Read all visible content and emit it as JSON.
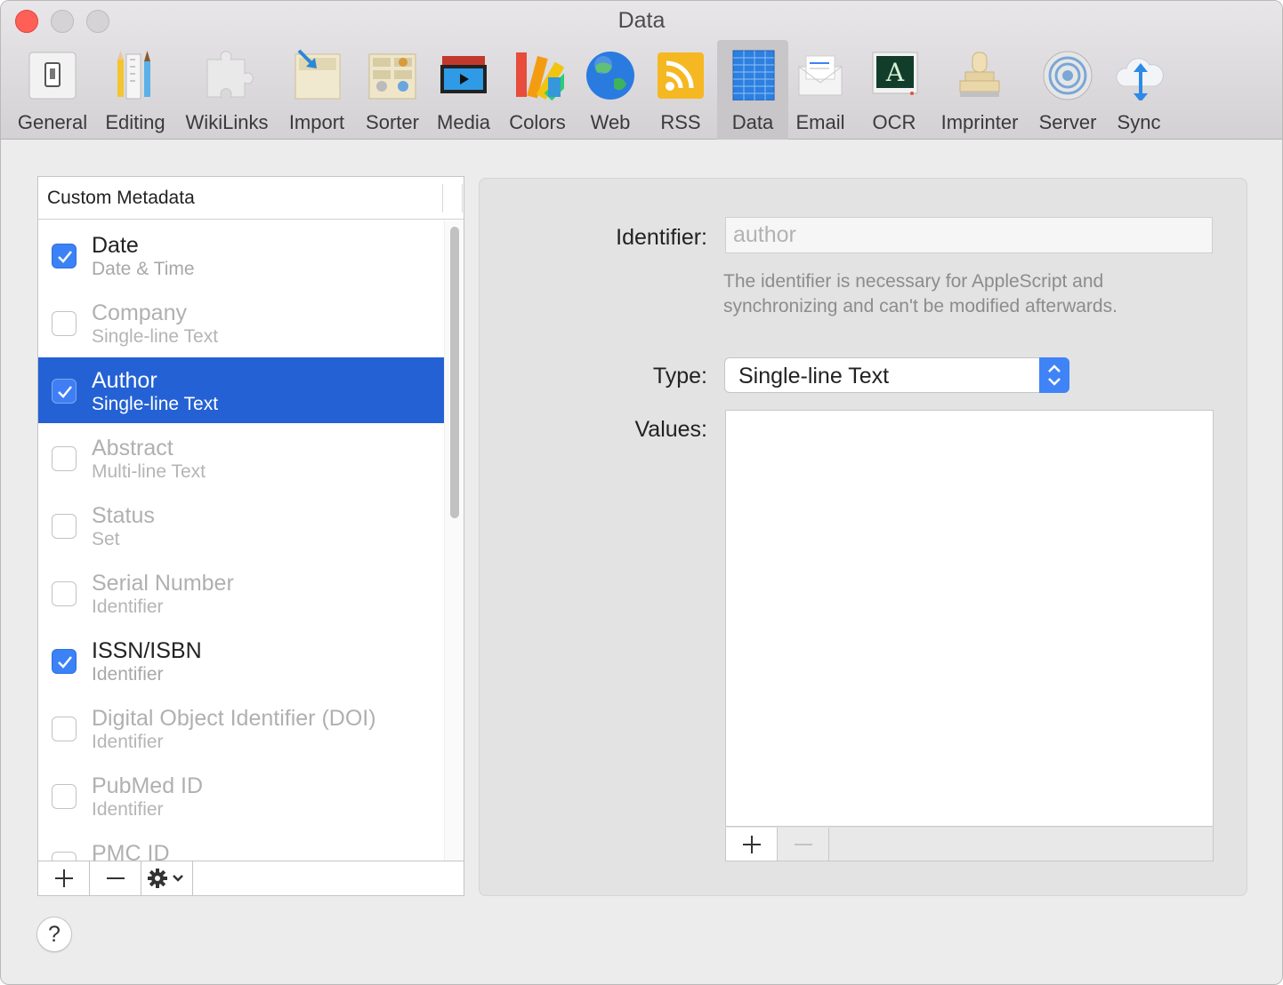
{
  "window": {
    "title": "Data"
  },
  "toolbar": {
    "selected": "Data",
    "items": [
      {
        "label": "General",
        "icon": "switch-icon"
      },
      {
        "label": "Editing",
        "icon": "pencil-ruler-icon"
      },
      {
        "label": "WikiLinks",
        "icon": "puzzle-icon"
      },
      {
        "label": "Import",
        "icon": "import-icon"
      },
      {
        "label": "Sorter",
        "icon": "sorter-icon"
      },
      {
        "label": "Media",
        "icon": "media-icon"
      },
      {
        "label": "Colors",
        "icon": "color-swatches-icon"
      },
      {
        "label": "Web",
        "icon": "globe-icon"
      },
      {
        "label": "RSS",
        "icon": "rss-icon"
      },
      {
        "label": "Data",
        "icon": "data-grid-icon"
      },
      {
        "label": "Email",
        "icon": "envelope-icon"
      },
      {
        "label": "OCR",
        "icon": "ocr-icon"
      },
      {
        "label": "Imprinter",
        "icon": "stamp-icon"
      },
      {
        "label": "Server",
        "icon": "server-icon"
      },
      {
        "label": "Sync",
        "icon": "cloud-sync-icon"
      }
    ]
  },
  "metadata_list": {
    "header": "Custom Metadata",
    "items": [
      {
        "title": "Date",
        "subtitle": "Date & Time",
        "checked": true,
        "selected": false
      },
      {
        "title": "Company",
        "subtitle": "Single-line Text",
        "checked": false,
        "selected": false
      },
      {
        "title": "Author",
        "subtitle": "Single-line Text",
        "checked": true,
        "selected": true
      },
      {
        "title": "Abstract",
        "subtitle": "Multi-line Text",
        "checked": false,
        "selected": false
      },
      {
        "title": "Status",
        "subtitle": "Set",
        "checked": false,
        "selected": false
      },
      {
        "title": "Serial Number",
        "subtitle": "Identifier",
        "checked": false,
        "selected": false
      },
      {
        "title": "ISSN/ISBN",
        "subtitle": "Identifier",
        "checked": true,
        "selected": false
      },
      {
        "title": "Digital Object Identifier (DOI)",
        "subtitle": "Identifier",
        "checked": false,
        "selected": false
      },
      {
        "title": "PubMed ID",
        "subtitle": "Identifier",
        "checked": false,
        "selected": false
      },
      {
        "title": "PMC ID",
        "subtitle": "",
        "checked": false,
        "selected": false
      }
    ],
    "footer": {
      "add_label": "+",
      "remove_label": "−",
      "action_label": "⚙⌄"
    }
  },
  "detail": {
    "identifier_label": "Identifier:",
    "identifier_value": "author",
    "help_text": "The identifier is necessary for AppleScript and synchronizing and can't be modified afterwards.",
    "type_label": "Type:",
    "type_value": "Single-line Text",
    "values_label": "Values:",
    "values": [],
    "values_add_label": "+",
    "values_remove_label": "−"
  },
  "help_button_label": "?"
}
